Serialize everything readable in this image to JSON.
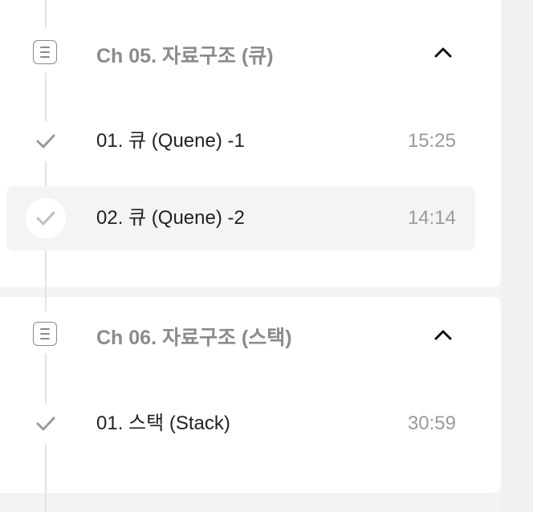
{
  "chapters": [
    {
      "title": "Ch 05. 자료구조 (큐)",
      "expand_icon": "chevron-up-icon",
      "lessons": [
        {
          "title": "01. 큐 (Quene) -1",
          "duration": "15:25",
          "completed": true,
          "active": false
        },
        {
          "title": "02. 큐 (Quene) -2",
          "duration": "14:14",
          "completed": true,
          "active": true
        }
      ]
    },
    {
      "title": "Ch 06. 자료구조 (스택)",
      "expand_icon": "chevron-up-icon",
      "lessons": [
        {
          "title": "01. 스택 (Stack)",
          "duration": "30:59",
          "completed": true,
          "active": false
        }
      ]
    }
  ],
  "colors": {
    "background": "#f3f3f3",
    "panel": "#ffffff",
    "active_row": "#f4f4f4",
    "muted_text": "#8b8b8b",
    "timeline": "#e3e3e3"
  }
}
